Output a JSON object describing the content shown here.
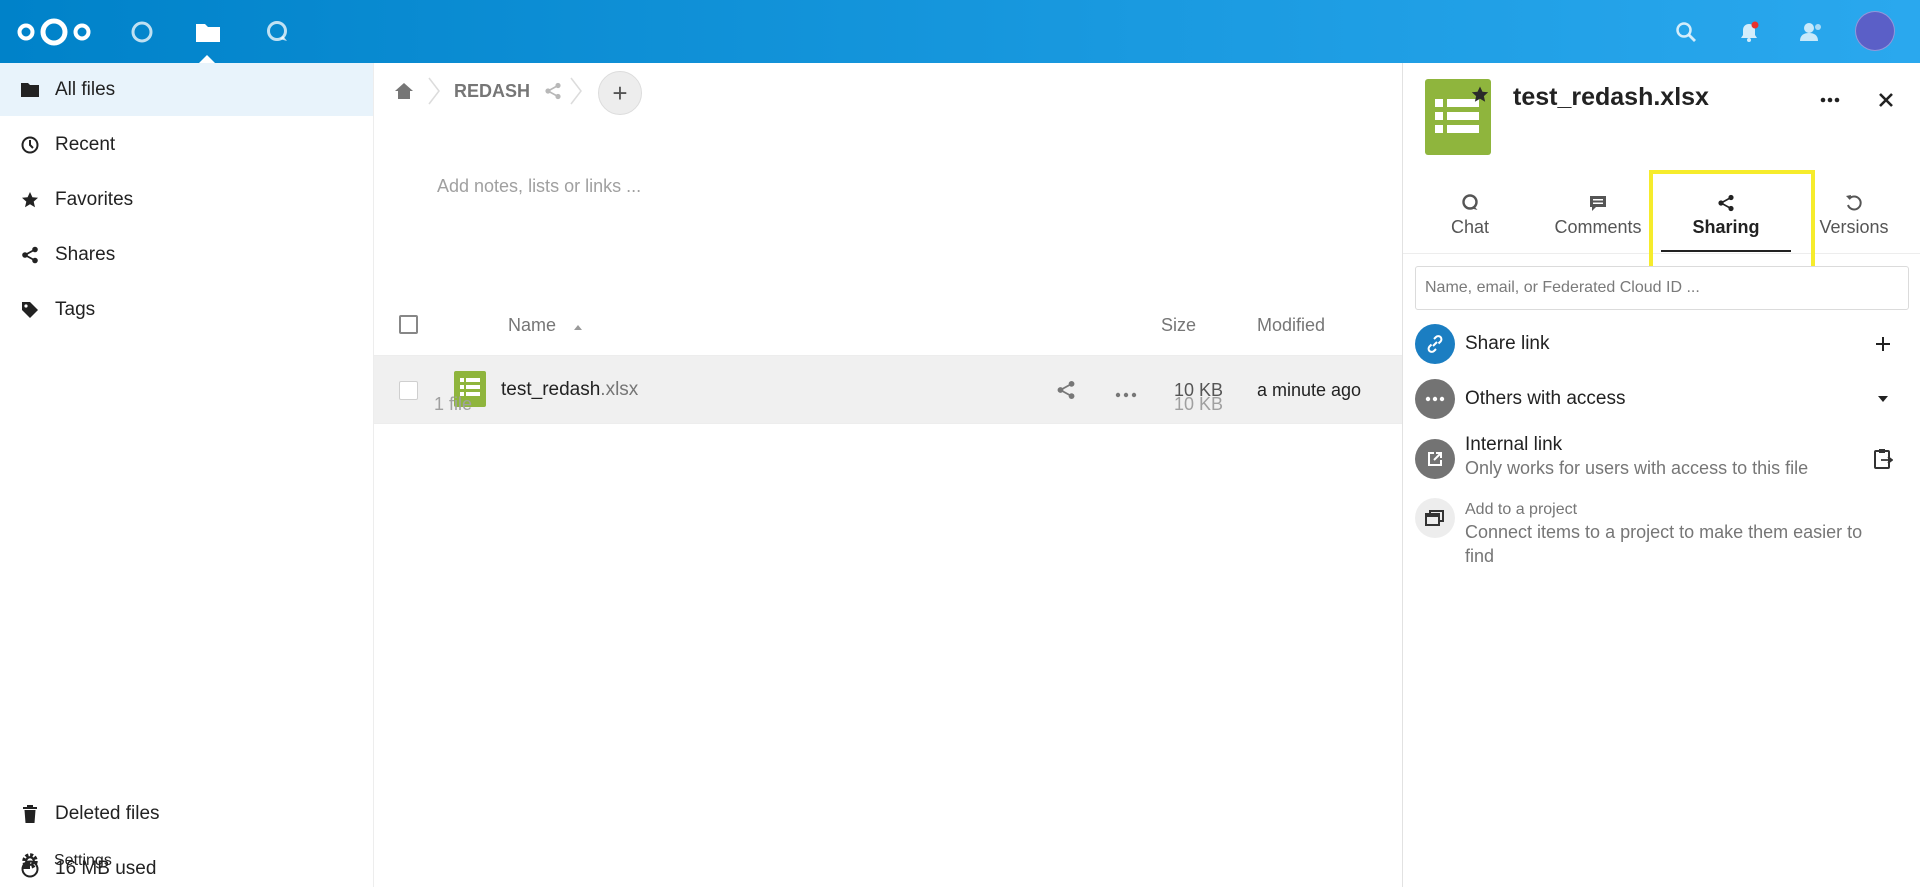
{
  "header": {
    "apps": [
      {
        "name": "dashboard",
        "icon": "circle-icon"
      },
      {
        "name": "files",
        "icon": "folder-icon",
        "active": true
      },
      {
        "name": "talk",
        "icon": "talk-icon"
      }
    ],
    "right_icons": [
      "search-icon",
      "bell-icon",
      "contacts-icon"
    ],
    "brand_color": "#0082c9",
    "notification_dot_color": "#e9322d"
  },
  "nav": {
    "items": [
      {
        "label": "All files",
        "icon": "folder-icon",
        "active": true
      },
      {
        "label": "Recent",
        "icon": "clock-icon"
      },
      {
        "label": "Favorites",
        "icon": "star-icon"
      },
      {
        "label": "Shares",
        "icon": "share-icon"
      },
      {
        "label": "Tags",
        "icon": "tag-icon"
      }
    ],
    "bottom": [
      {
        "label": "Deleted files",
        "icon": "trash-icon"
      },
      {
        "label": "16 MB used",
        "icon": "pie-chart-icon"
      },
      {
        "label": "Settings",
        "icon": "gear-icon"
      }
    ]
  },
  "main": {
    "breadcrumb": {
      "home_icon": "home-icon",
      "folder": "REDASH",
      "folder_share_icon": "share-icon"
    },
    "add_button": "+",
    "notes_placeholder": "Add notes, lists or links ...",
    "columns": {
      "name": "Name",
      "size": "Size",
      "modified": "Modified"
    },
    "files": [
      {
        "basename": "test_redash",
        "ext": ".xlsx",
        "size": "10 KB",
        "modified": "a minute ago",
        "icon": "spreadsheet-icon"
      }
    ],
    "summary": {
      "count": "1 file",
      "size": "10 KB"
    }
  },
  "sidebar": {
    "title": "test_redash.xlsx",
    "tabs": [
      {
        "label": "Chat",
        "icon": "talk-icon"
      },
      {
        "label": "Comments",
        "icon": "comment-icon"
      },
      {
        "label": "Sharing",
        "icon": "share-icon",
        "active": true
      },
      {
        "label": "Versions",
        "icon": "history-icon"
      }
    ],
    "share_input_placeholder": "Name, email, or Federated Cloud ID ...",
    "entries": {
      "share_link": {
        "title": "Share link",
        "action": "+"
      },
      "others": {
        "title": "Others with access"
      },
      "internal": {
        "title": "Internal link",
        "subtitle": "Only works for users with access to this file"
      },
      "project": {
        "title": "Add to a project",
        "subtitle": "Connect items to a project to make them easier to find"
      }
    },
    "highlight_color": "#f6ec2c"
  }
}
